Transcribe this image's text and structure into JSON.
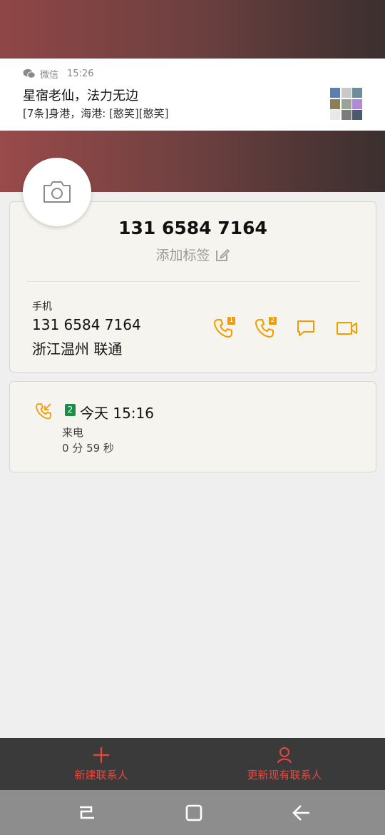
{
  "notification": {
    "app_name": "微信",
    "time": "15:26",
    "title": "星宿老仙，法力无边",
    "body": "[7条]身港，海港: [憨笑][憨笑]"
  },
  "contact": {
    "number_title": "131 6584 7164",
    "add_tag": "添加标签",
    "phone_label": "手机",
    "phone_number": "131 6584 7164",
    "location": "浙江温州 联通",
    "actions": [
      {
        "icon": "phone-sim1-icon",
        "badge": "1"
      },
      {
        "icon": "phone-sim2-icon",
        "badge": "2"
      },
      {
        "icon": "message-icon"
      },
      {
        "icon": "video-call-icon"
      }
    ]
  },
  "call_log": {
    "sim": "2",
    "time": "今天 15:16",
    "type": "来电",
    "duration": "0 分 59 秒"
  },
  "bottom_bar": {
    "new_contact": "新建联系人",
    "update_contact": "更新现有联系人"
  },
  "colors": {
    "accent_orange": "#f49b00",
    "bottom_red": "#e8473e",
    "sim_green": "#1c8c46"
  }
}
